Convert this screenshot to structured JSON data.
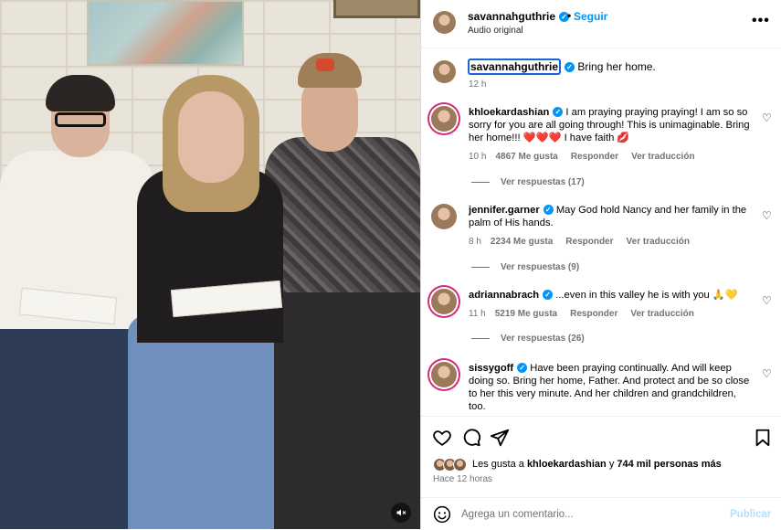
{
  "post": {
    "username": "savannahguthrie",
    "follow_separator": "•",
    "follow_label": "Seguir",
    "audio_label": "Audio original",
    "more_label": "•••",
    "caption_text": "Bring her home.",
    "caption_time": "12 h"
  },
  "comments": [
    {
      "username": "khloekardashian",
      "text": "I am praying praying praying! I am so so sorry for you are all going through! This is unimaginable. Bring her home!!! ❤️❤️❤️ I have faith 💋",
      "time": "10 h",
      "likes": "4867 Me gusta",
      "reply": "Responder",
      "translate": "Ver traducción",
      "replies": "Ver respuestas (17)"
    },
    {
      "username": "jennifer.garner",
      "text": "May God hold Nancy and her family in the palm of His hands.",
      "time": "8 h",
      "likes": "2234 Me gusta",
      "reply": "Responder",
      "translate": "Ver traducción",
      "replies": "Ver respuestas (9)"
    },
    {
      "username": "adriannabrach",
      "text": "...even in this valley he is with you 🙏💛",
      "time": "11 h",
      "likes": "5219 Me gusta",
      "reply": "Responder",
      "translate": "Ver traducción",
      "replies": "Ver respuestas (26)"
    },
    {
      "username": "sissygoff",
      "text": "Have been praying continually. And will keep doing so. Bring her home, Father. And protect and be so close to her this very minute. And her children and grandchildren, too."
    }
  ],
  "likes": {
    "prefix": "Les gusta a",
    "first_user": "khloekardashian",
    "joiner": "y",
    "others": "744 mil personas más"
  },
  "posted_time": "Hace 12 horas",
  "comment_box": {
    "placeholder": "Agrega un comentario...",
    "publish_label": "Publicar"
  },
  "colors": {
    "accent": "#0095f6",
    "muted_text": "#737373",
    "publish_disabled": "#b2dffc",
    "story_ring": "#d62976"
  }
}
